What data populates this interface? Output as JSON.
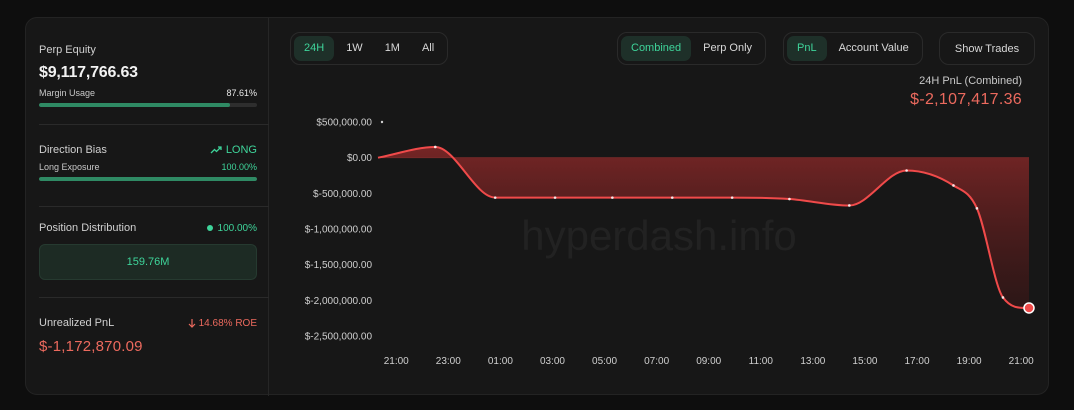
{
  "summary": {
    "perp_equity_label": "Perp Equity",
    "perp_equity_value": "$9,117,766.63",
    "margin_usage_label": "Margin Usage",
    "margin_usage_value": "87.61%",
    "margin_usage_fraction": 0.8761,
    "direction_bias_label": "Direction Bias",
    "direction_bias_value": "LONG",
    "long_exposure_label": "Long Exposure",
    "long_exposure_value": "100.00%",
    "long_exposure_fraction": 1.0,
    "position_distribution_label": "Position Distribution",
    "position_distribution_pct": "100.00%",
    "position_distribution_amount": "159.76M",
    "unrealized_pnl_label": "Unrealized PnL",
    "unrealized_pnl_roe": "14.68% ROE",
    "unrealized_pnl_value": "$-1,172,870.09"
  },
  "controls": {
    "timeframes": [
      "24H",
      "1W",
      "1M",
      "All"
    ],
    "timeframe_selected": "24H",
    "modes": [
      "Combined",
      "Perp Only"
    ],
    "mode_selected": "Combined",
    "metrics": [
      "PnL",
      "Account Value"
    ],
    "metric_selected": "PnL",
    "show_trades_label": "Show Trades"
  },
  "pnl_header": {
    "caption": "24H PnL (Combined)",
    "value": "$-2,107,417.36"
  },
  "watermark": "hyperdash.info",
  "colors": {
    "accent_green": "#3ed49a",
    "negative_red": "#ec6a5e",
    "line_red": "#f04a4a"
  },
  "chart_data": {
    "type": "area",
    "title": "",
    "xlabel": "",
    "ylabel": "",
    "x_ticks": [
      "21:00",
      "23:00",
      "01:00",
      "03:00",
      "05:00",
      "07:00",
      "09:00",
      "11:00",
      "13:00",
      "15:00",
      "17:00",
      "19:00",
      "21:00"
    ],
    "y_ticks": [
      500000,
      0,
      -500000,
      -1000000,
      -1500000,
      -2000000,
      -2500000
    ],
    "y_tick_labels": [
      "$500,000.00",
      "$0.00",
      "$-500,000.00",
      "$-1,000,000.00",
      "$-1,500,000.00",
      "$-2,000,000.00",
      "$-2,500,000.00"
    ],
    "xlim_hours": [
      -0.7,
      24.3
    ],
    "ylim": [
      -2500000,
      500000
    ],
    "series": [
      {
        "x_hours": [
          -0.7,
          1.5,
          3.8,
          6.1,
          8.3,
          10.6,
          12.9,
          15.1,
          17.4,
          19.6,
          21.4,
          22.3,
          23.3,
          24.2,
          24.3
        ],
        "values": [
          0,
          150000,
          -560000,
          -560000,
          -560000,
          -560000,
          -560000,
          -580000,
          -670000,
          -180000,
          -390000,
          -710000,
          -1960000,
          -2107417,
          -2107417
        ]
      }
    ],
    "grid": false,
    "legend": "none"
  }
}
